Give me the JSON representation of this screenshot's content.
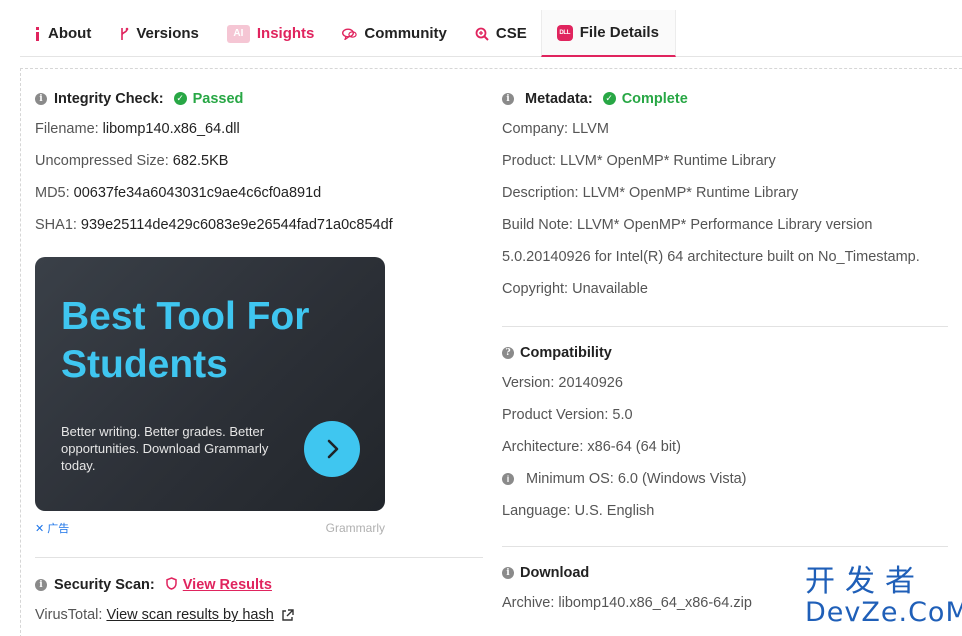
{
  "tabs": [
    {
      "label": "About",
      "icon": "info-icon",
      "glyph": "i"
    },
    {
      "label": "Versions",
      "icon": "branch-icon",
      "glyph": "ᵽ"
    },
    {
      "label": "Insights",
      "icon": "ai-icon",
      "glyph": "AI"
    },
    {
      "label": "Community",
      "icon": "chat-icon",
      "glyph": "🗨"
    },
    {
      "label": "CSE",
      "icon": "search-icon",
      "glyph": "⊕"
    },
    {
      "label": "File Details",
      "icon": "dll-icon",
      "glyph": "DLL"
    }
  ],
  "integrity": {
    "label": "Integrity Check:",
    "status": "Passed",
    "filename_label": "Filename:",
    "filename": "libomp140.x86_64.dll",
    "size_label": "Uncompressed Size:",
    "size": "682.5KB",
    "md5_label": "MD5:",
    "md5": "00637fe34a6043031c9ae4c6cf0a891d",
    "sha1_label": "SHA1:",
    "sha1": "939e25114de429c6083e9e26544fad71a0c854df"
  },
  "ad": {
    "title_line1": "Best Tool For",
    "title_line2": "Students",
    "copy": "Better writing. Better grades. Better opportunities. Download Grammarly today.",
    "close_label": "✕ 广告",
    "brand": "Grammarly"
  },
  "security": {
    "label": "Security Scan:",
    "view_results": "View Results",
    "virustotal_label": "VirusTotal:",
    "virustotal_link": "View scan results by hash"
  },
  "metadata": {
    "label": "Metadata:",
    "status": "Complete",
    "company": "Company: LLVM",
    "product": "Product: LLVM* OpenMP* Runtime Library",
    "description": "Description: LLVM* OpenMP* Runtime Library",
    "build_note_1": "Build Note: LLVM* OpenMP* Performance Library version",
    "build_note_2": "5.0.20140926 for Intel(R) 64 architecture built on No_Timestamp.",
    "copyright": "Copyright: Unavailable"
  },
  "compatibility": {
    "label": "Compatibility",
    "version": "Version: 20140926",
    "product_version": "Product Version: 5.0",
    "architecture": "Architecture: x86-64 (64 bit)",
    "minimum_os": "Minimum OS: 6.0 (Windows Vista)",
    "language": "Language: U.S. English"
  },
  "download": {
    "label": "Download",
    "archive": "Archive: libomp140.x86_64_x86-64.zip"
  },
  "watermark": {
    "cn": "开发者",
    "en": "DevZe.CoM"
  },
  "colors": {
    "accent": "#e0245e",
    "success": "#28a745",
    "ad_cyan": "#3fc6f0"
  }
}
